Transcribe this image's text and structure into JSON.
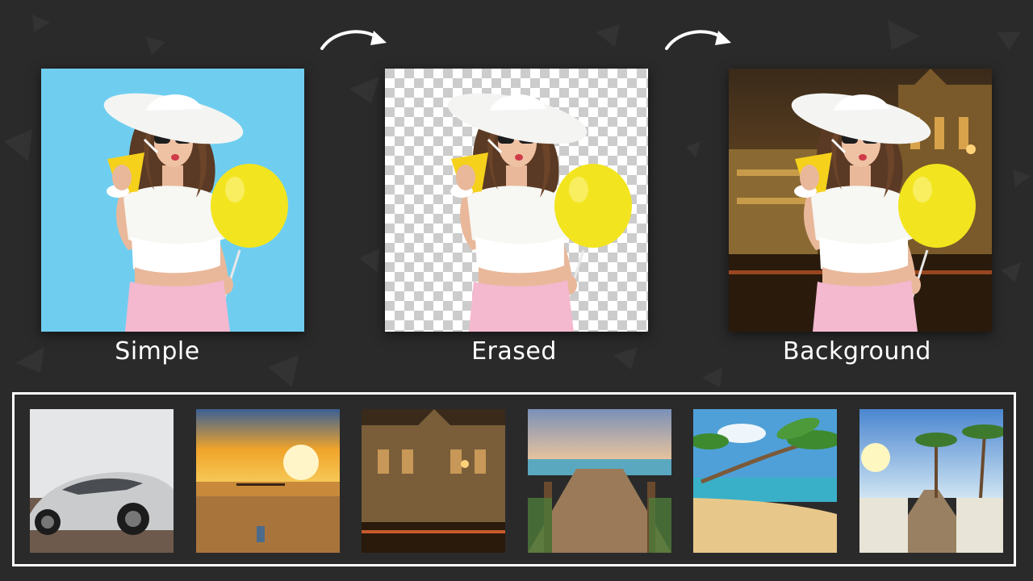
{
  "stages": [
    {
      "label": "Simple",
      "background": "sky-blue-backdrop"
    },
    {
      "label": "Erased",
      "background": "transparency-checkerboard"
    },
    {
      "label": "Background",
      "background": "illuminated-station-at-night"
    }
  ],
  "backgrounds": [
    {
      "name": "sports-car"
    },
    {
      "name": "sunset-beach"
    },
    {
      "name": "night-station"
    },
    {
      "name": "pier-sunset"
    },
    {
      "name": "palm-beach"
    },
    {
      "name": "boardwalk-palms"
    }
  ],
  "colors": {
    "page_background": "#2a2a2a",
    "sky_blue": "#5fc8ee",
    "balloon_yellow": "#f2e51f",
    "skirt_pink": "#f4b8cf",
    "strip_border": "#ffffff"
  }
}
